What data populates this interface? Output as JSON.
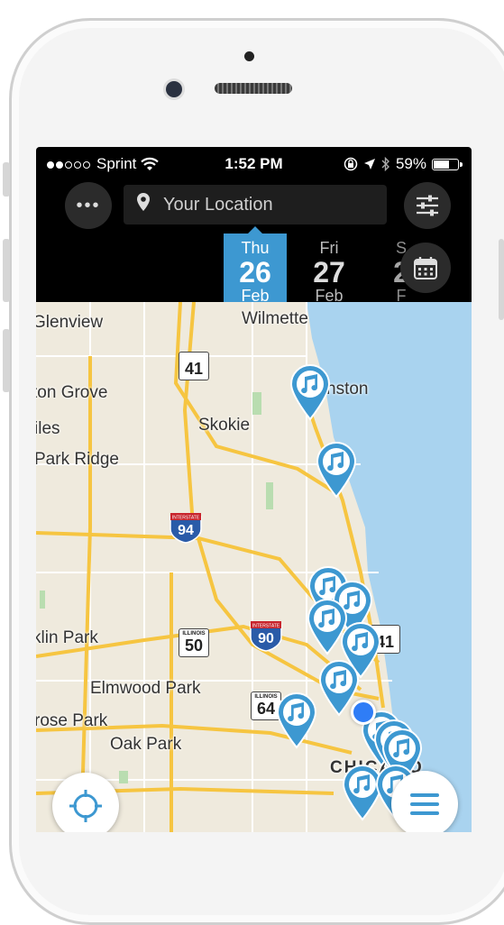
{
  "status_bar": {
    "carrier": "Sprint",
    "time": "1:52 PM",
    "battery": "59%",
    "signal_bars_filled": 2,
    "signal_bars_total": 5
  },
  "toolbar": {
    "location_placeholder": "Your Location",
    "more_icon": "ellipsis-icon",
    "filters_icon": "sliders-icon"
  },
  "dates": [
    {
      "dow": "Thu",
      "day": "26",
      "month": "Feb",
      "selected": true
    },
    {
      "dow": "Fri",
      "day": "27",
      "month": "Feb",
      "selected": false
    }
  ],
  "date_partial": {
    "dow": "S",
    "day": "2",
    "month": "F"
  },
  "map": {
    "labels": {
      "glenview": "Glenview",
      "wilmette": "Wilmette",
      "evanston": "nston",
      "morton_grove": "ton Grove",
      "skokie": "Skokie",
      "niles": "iles",
      "park_ridge": "Park Ridge",
      "franklin_park": "klin Park",
      "elmwood_park": "Elmwood Park",
      "melrose_park": "rose Park",
      "oak_park": "Oak Park",
      "chicago": "CHICAGO"
    },
    "shields": {
      "us41_north": "41",
      "us41_south": "41",
      "il50": "50",
      "il64": "64",
      "i94": "94",
      "i90": "90",
      "state_label": "ILLINOIS",
      "interstate_label": "INTERSTATE"
    },
    "colors": {
      "land": "#efeadd",
      "water": "#a9d3ef",
      "highway": "#f6c541",
      "accent": "#3d98d1"
    }
  },
  "buttons": {
    "locate_icon": "crosshair-icon",
    "menu_icon": "hamburger-menu-icon",
    "calendar_icon": "calendar-icon"
  }
}
